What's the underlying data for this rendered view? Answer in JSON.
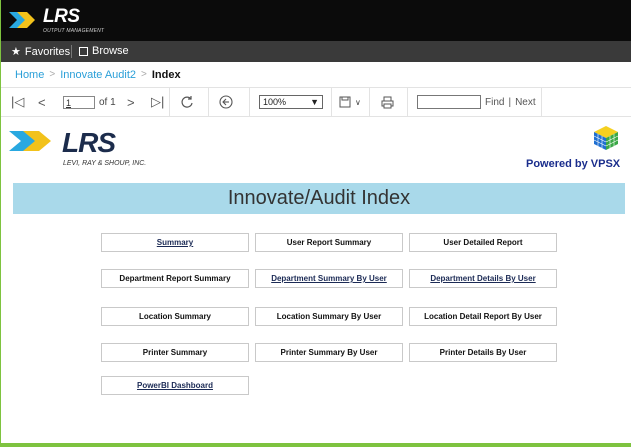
{
  "brand": {
    "logo_text": "LRS",
    "logo_sub": "OUTPUT MANAGEMENT"
  },
  "favbar": {
    "favorites": "Favorites",
    "browse": "Browse"
  },
  "breadcrumb": {
    "items": [
      "Home",
      "Innovate Audit2"
    ],
    "current": "Index"
  },
  "toolbar": {
    "page_value": "1",
    "page_of": "of 1",
    "zoom": "100%",
    "find": "Find",
    "sep": "|",
    "next": "Next"
  },
  "report": {
    "logo_text": "LRS",
    "logo_sub": "LEVI, RAY & SHOUP, INC.",
    "powered": "Powered by VPSX",
    "title": "Innovate/Audit Index",
    "buttons": [
      "Summary",
      "User Report Summary",
      "User Detailed Report",
      "Department Report Summary",
      "Department Summary By User",
      "Department Details By User",
      "Location Summary",
      "Location Summary By User",
      "Location Detail Report By User",
      "Printer Summary",
      "Printer Summary By User",
      "Printer Details By User",
      "PowerBI Dashboard"
    ]
  },
  "colors": {
    "accent": "#2a9fd8",
    "title_band": "#a9d9ea",
    "frame": "#7ec33f",
    "brand_bar": "#0b0b0b"
  }
}
